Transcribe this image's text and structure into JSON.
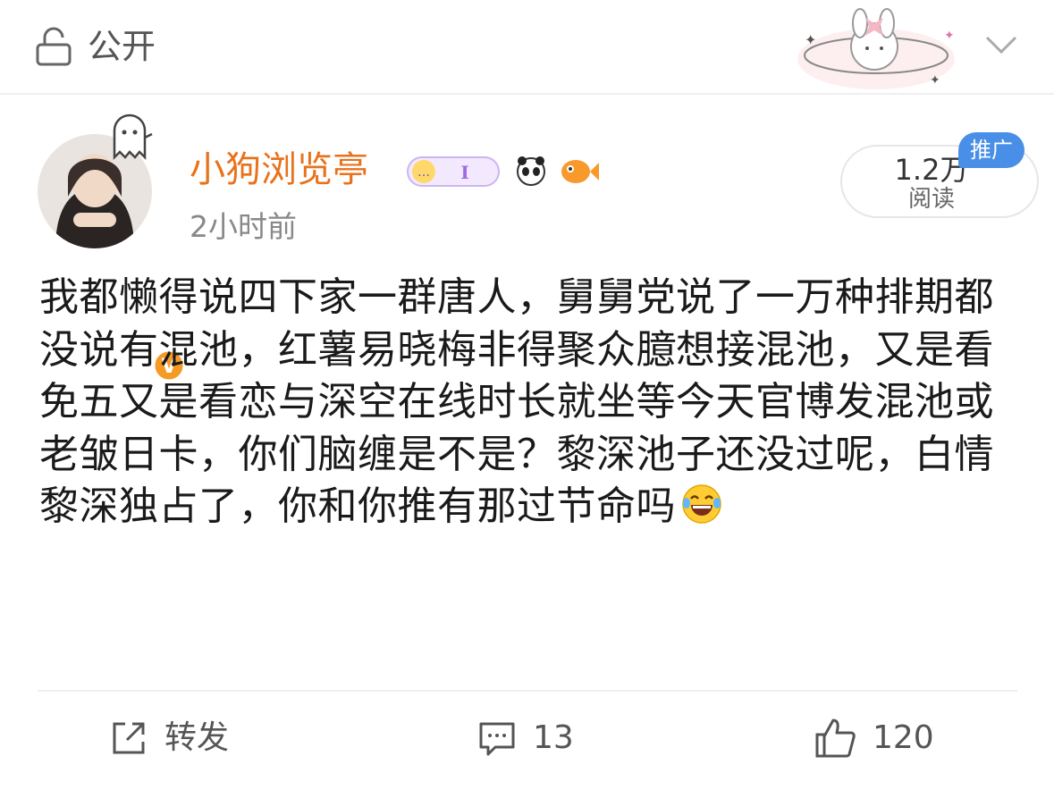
{
  "header": {
    "visibility_label": "公开"
  },
  "post": {
    "username": "小狗浏览亭",
    "time": "2小时前",
    "reads_count": "1.2万",
    "reads_label": "阅读",
    "promo_tag": "推广",
    "body": "我都懒得说四下家一群唐人，舅舅党说了一万种排期都没说有混池，红薯易晓梅非得聚众臆想接混池，又是看免五又是看恋与深空在线时长就坐等今天官博发混池或老皱日卡，你们脑缠是不是？黎深池子还没过呢，白情黎深独占了，你和你推有那过节命吗"
  },
  "actions": {
    "repost_label": "转发",
    "comment_count": "13",
    "like_count": "120"
  },
  "colors": {
    "username": "#e8721c",
    "verified": "#f59a23",
    "promo": "#4a8fe7"
  }
}
